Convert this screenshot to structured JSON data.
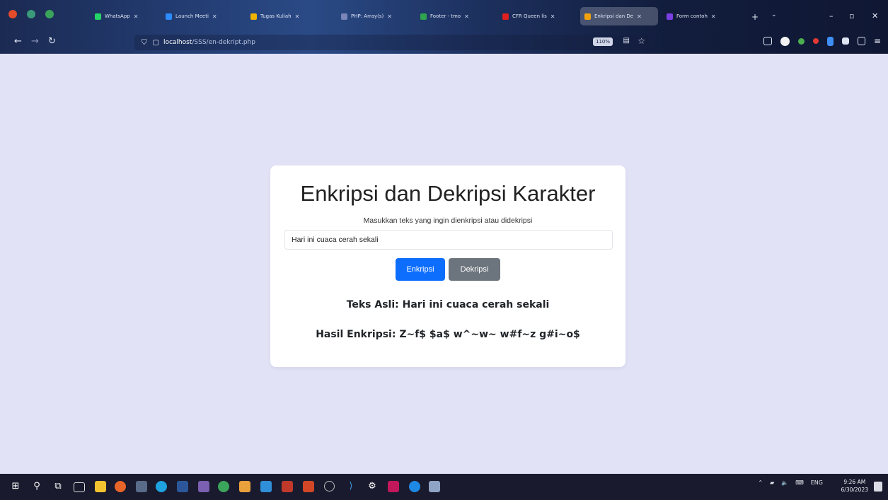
{
  "browser": {
    "tabs": [
      {
        "title": "WhatsApp",
        "color": "#25d366",
        "active": false
      },
      {
        "title": "Launch Meeti",
        "color": "#2d8cff",
        "active": false
      },
      {
        "title": "Tugas Kuliah",
        "color": "#f0b400",
        "active": false
      },
      {
        "title": "PHP: Array(s)",
        "color": "#7a86b8",
        "active": false
      },
      {
        "title": "Footer - tmo",
        "color": "#2ea44f",
        "active": false
      },
      {
        "title": "CFR Queen lis",
        "color": "#e02020",
        "active": false
      },
      {
        "title": "Enkripsi dan De",
        "color": "#f3a20c",
        "active": true
      },
      {
        "title": "Form contoh",
        "color": "#7b3fe4",
        "active": false
      }
    ],
    "url_host": "localhost",
    "url_path": "/SSS/en-dekript.php",
    "zoom": "110%"
  },
  "page": {
    "title": "Enkripsi dan Dekripsi Karakter",
    "input_label": "Masukkan teks yang ingin dienkripsi atau didekripsi",
    "input_value": "Hari ini cuaca cerah sekali",
    "encrypt_button": "Enkripsi",
    "decrypt_button": "Dekripsi",
    "original_text": "Teks Asli: Hari ini cuaca cerah sekali",
    "encrypted_result": "Hasil Enkripsi: Z~f$ $a$ w^~w~ w#f~z g#i~o$"
  },
  "taskbar": {
    "lang": "ENG",
    "time": "9:26 AM",
    "date": "6/30/2023"
  },
  "colors": {
    "page_background": "#e2e2f7",
    "primary_button": "#0d6efd",
    "secondary_button": "#6c757d"
  }
}
